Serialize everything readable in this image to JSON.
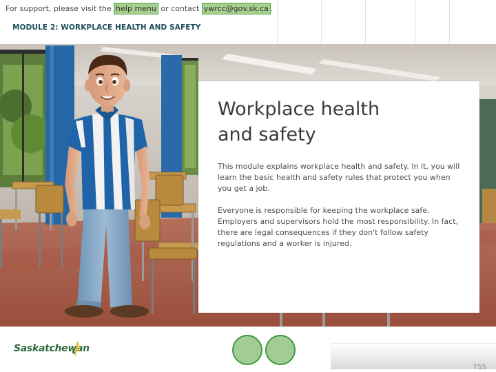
{
  "header": {
    "support_prefix": "For support, please visit the ",
    "help_link": "help menu",
    "support_middle": " or contact ",
    "email_link": "ywrcc@gov.sk.ca",
    "support_suffix": ".",
    "module_title": "MODULE 2: WORKPLACE HEALTH AND SAFETY"
  },
  "card": {
    "title_line1": "Workplace health",
    "title_line2": "and safety",
    "paragraph1": "This module explains workplace health and safety. In it, you will learn the basic health and safety rules that protect you when you get a job.",
    "paragraph2": "Everyone is responsible for keeping the workplace safe. Employers and supervisors hold the most responsibility. In fact, there are legal consequences if they don't follow safety regulations and a worker is injured."
  },
  "footer": {
    "logo_text": "Saskatchewan",
    "page_number": "T55"
  },
  "colors": {
    "module_title": "#1d4e5a",
    "highlight": "#a7cf8f",
    "nav_button": "#a2cc94",
    "nav_border": "#3f9a42",
    "logo": "#2d6b3c"
  }
}
